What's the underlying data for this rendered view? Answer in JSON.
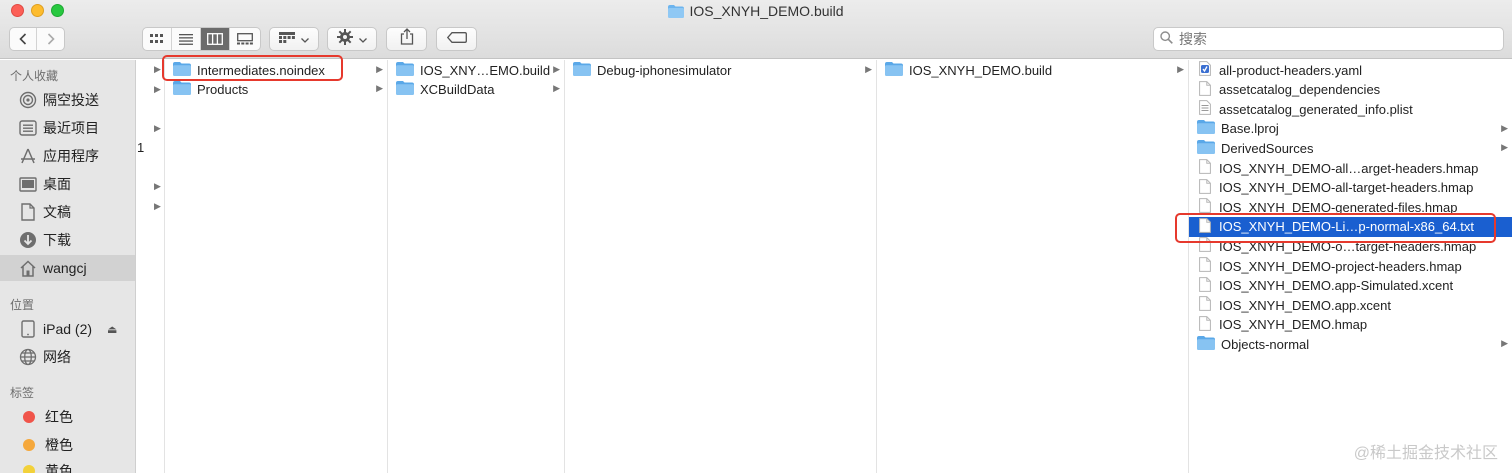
{
  "window": {
    "title": "IOS_XNYH_DEMO.build"
  },
  "toolbar": {
    "back_icon": "chevron-left-icon",
    "forward_icon": "chevron-right-icon",
    "view_modes": [
      "icon-view-icon",
      "list-view-icon",
      "column-view-icon",
      "gallery-view-icon"
    ],
    "active_view": "column",
    "group_icon": "group-by-icon",
    "action_icon": "gear-icon",
    "share_icon": "share-icon",
    "tag_icon": "tag-icon",
    "search_placeholder": "搜索"
  },
  "sidebar": {
    "favorites_header": "个人收藏",
    "favorites": [
      {
        "label": "隔空投送",
        "icon": "airdrop-icon"
      },
      {
        "label": "最近项目",
        "icon": "recents-icon"
      },
      {
        "label": "应用程序",
        "icon": "applications-icon"
      },
      {
        "label": "桌面",
        "icon": "desktop-icon"
      },
      {
        "label": "文稿",
        "icon": "documents-icon"
      },
      {
        "label": "下载",
        "icon": "downloads-icon"
      },
      {
        "label": "wangcj",
        "icon": "home-icon"
      }
    ],
    "locations_header": "位置",
    "locations": [
      {
        "label": "iPad (2)",
        "icon": "ipad-icon"
      },
      {
        "label": "网络",
        "icon": "network-icon"
      }
    ],
    "tags_header": "标签",
    "tags": [
      {
        "label": "红色",
        "color": "#f0544a"
      },
      {
        "label": "橙色",
        "color": "#f5a83c"
      },
      {
        "label": "黄色",
        "color": "#f2d13a"
      }
    ]
  },
  "column0": {
    "label": "1"
  },
  "column1": {
    "items": [
      {
        "name": "Intermediates.noindex",
        "type": "folder",
        "has_children": true
      },
      {
        "name": "Products",
        "type": "folder",
        "has_children": true
      }
    ]
  },
  "column2": {
    "items": [
      {
        "name": "IOS_XNY…EMO.build",
        "type": "folder",
        "has_children": true
      },
      {
        "name": "XCBuildData",
        "type": "folder",
        "has_children": true
      }
    ]
  },
  "column3": {
    "items": [
      {
        "name": "Debug-iphonesimulator",
        "type": "folder",
        "has_children": true
      }
    ]
  },
  "column4": {
    "items": [
      {
        "name": "IOS_XNYH_DEMO.build",
        "type": "folder",
        "has_children": true
      }
    ]
  },
  "column5": {
    "items": [
      {
        "name": "all-product-headers.yaml",
        "type": "yaml"
      },
      {
        "name": "assetcatalog_dependencies",
        "type": "file"
      },
      {
        "name": "assetcatalog_generated_info.plist",
        "type": "plist"
      },
      {
        "name": "Base.lproj",
        "type": "folder",
        "has_children": true
      },
      {
        "name": "DerivedSources",
        "type": "folder",
        "has_children": true
      },
      {
        "name": "IOS_XNYH_DEMO-all…arget-headers.hmap",
        "type": "file"
      },
      {
        "name": "IOS_XNYH_DEMO-all-target-headers.hmap",
        "type": "file"
      },
      {
        "name": "IOS_XNYH_DEMO-generated-files.hmap",
        "type": "file"
      },
      {
        "name": "IOS_XNYH_DEMO-Li…p-normal-x86_64.txt",
        "type": "file",
        "selected": true
      },
      {
        "name": "IOS_XNYH_DEMO-o…target-headers.hmap",
        "type": "file"
      },
      {
        "name": "IOS_XNYH_DEMO-project-headers.hmap",
        "type": "file"
      },
      {
        "name": "IOS_XNYH_DEMO.app-Simulated.xcent",
        "type": "file"
      },
      {
        "name": "IOS_XNYH_DEMO.app.xcent",
        "type": "file"
      },
      {
        "name": "IOS_XNYH_DEMO.hmap",
        "type": "file"
      },
      {
        "name": "Objects-normal",
        "type": "folder",
        "has_children": true
      }
    ]
  },
  "watermark": "@稀土掘金技术社区",
  "colors": {
    "selection": "#1a5fd0",
    "folder": "#6cb4ee",
    "highlight": "#e6392d"
  }
}
